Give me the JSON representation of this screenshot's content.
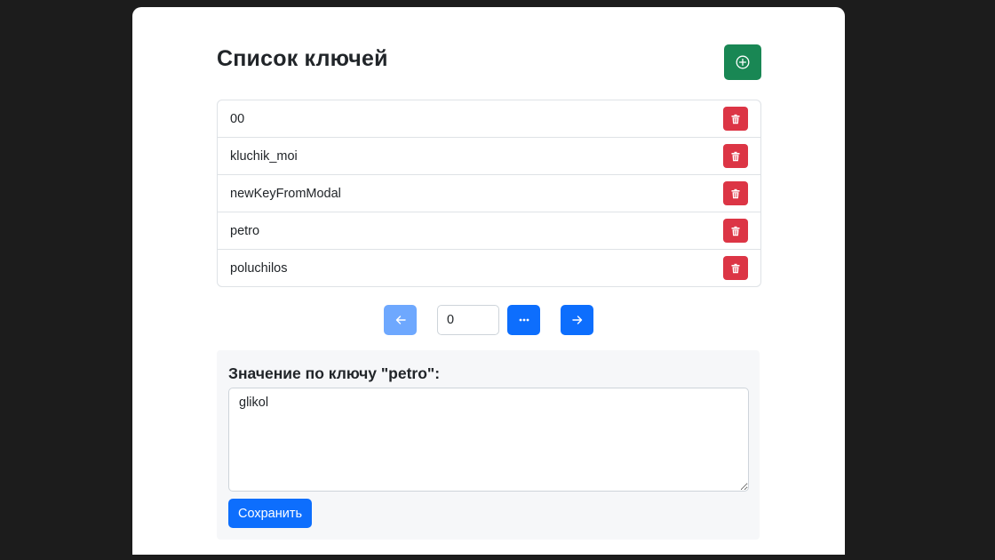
{
  "header": {
    "title": "Список ключей",
    "add_icon": "plus-circle-icon"
  },
  "keys": [
    {
      "label": "00"
    },
    {
      "label": "kluchik_moi"
    },
    {
      "label": "newKeyFromModal"
    },
    {
      "label": "petro"
    },
    {
      "label": "poluchilos"
    }
  ],
  "pager": {
    "page_value": "0",
    "prev_icon": "arrow-left-icon",
    "more_icon": "ellipsis-icon",
    "next_icon": "arrow-right-icon"
  },
  "value_panel": {
    "heading": "Значение по ключу \"petro\":",
    "value": "glikol",
    "save_label": "Сохранить"
  },
  "colors": {
    "add_button": "#198754",
    "delete_button": "#dc3545",
    "primary": "#0d6efd",
    "primary_disabled": "#6ea8fe",
    "background": "#1c1c1c"
  }
}
